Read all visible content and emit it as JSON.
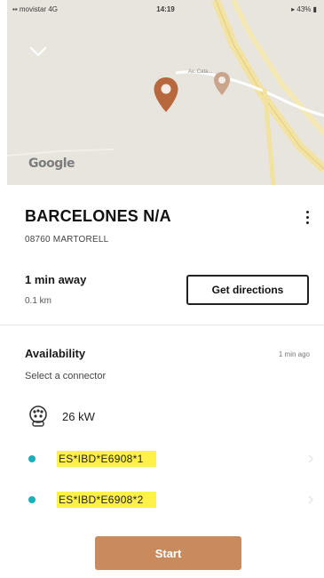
{
  "status_bar": {
    "carrier": "▪▪ movistar 4G",
    "time": "14:19",
    "battery": "▸ 43% ▮"
  },
  "map": {
    "provider_logo": "Google",
    "road_label": "Av. Cata..."
  },
  "station": {
    "name": "BARCELONES N/A",
    "address": "08760 MARTORELL"
  },
  "route": {
    "eta": "1 min away",
    "distance": "0.1 km",
    "directions_label": "Get directions"
  },
  "availability": {
    "title": "Availability",
    "updated": "1 min ago",
    "hint": "Select a connector",
    "power": "26 kW",
    "connectors": [
      {
        "id": "ES*IBD*E6908*1",
        "status_color": "#1ab0ba"
      },
      {
        "id": "ES*IBD*E6908*2",
        "status_color": "#1ab0ba"
      }
    ]
  },
  "actions": {
    "start_label": "Start"
  },
  "colors": {
    "accent": "#c98a5e",
    "available": "#1ab0ba",
    "highlight": "#fff04a"
  }
}
